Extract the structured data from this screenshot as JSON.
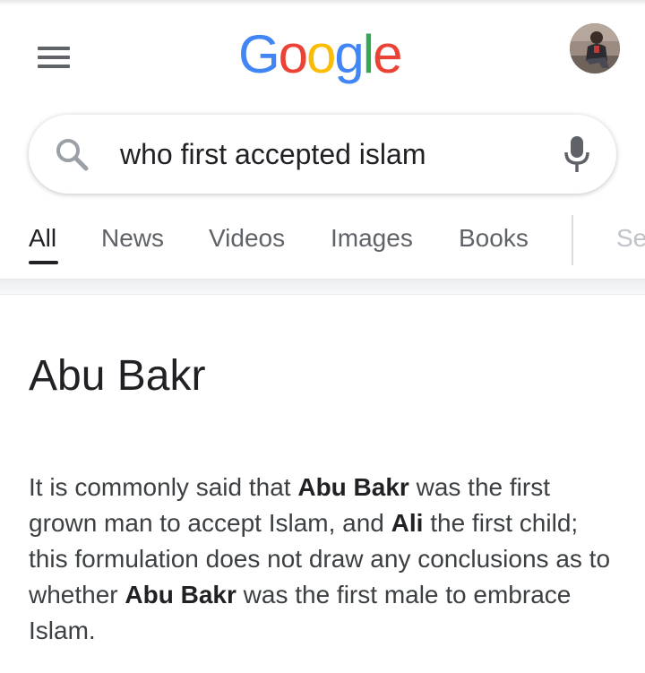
{
  "header": {
    "logo_letters": [
      {
        "char": "G",
        "color": "#4285F4"
      },
      {
        "char": "o",
        "color": "#EA4335"
      },
      {
        "char": "o",
        "color": "#FBBC05"
      },
      {
        "char": "g",
        "color": "#4285F4"
      },
      {
        "char": "l",
        "color": "#34A853"
      },
      {
        "char": "e",
        "color": "#EA4335"
      }
    ],
    "menu_icon": "hamburger-menu-icon",
    "avatar_icon": "user-avatar"
  },
  "search": {
    "query": "who first accepted islam",
    "search_icon": "search-icon",
    "mic_icon": "microphone-icon"
  },
  "tabs": [
    {
      "label": "All",
      "active": true
    },
    {
      "label": "News",
      "active": false
    },
    {
      "label": "Videos",
      "active": false
    },
    {
      "label": "Images",
      "active": false
    },
    {
      "label": "Books",
      "active": false
    },
    {
      "label": "Se",
      "active": false
    }
  ],
  "result": {
    "title": "Abu Bakr",
    "snippet_parts": [
      {
        "text": "It is commonly said that ",
        "bold": false
      },
      {
        "text": "Abu Bakr",
        "bold": true
      },
      {
        "text": " was the first grown man to accept Islam, and ",
        "bold": false
      },
      {
        "text": "Ali",
        "bold": true
      },
      {
        "text": " the first child; this formulation does not draw any conclusions as to whether ",
        "bold": false
      },
      {
        "text": "Abu Bakr",
        "bold": true
      },
      {
        "text": " was the first male to embrace Islam.",
        "bold": false
      }
    ]
  },
  "colors": {
    "text_primary": "#202124",
    "text_secondary": "#5f6368",
    "google_blue": "#4285F4",
    "google_red": "#EA4335",
    "google_yellow": "#FBBC05",
    "google_green": "#34A853"
  }
}
